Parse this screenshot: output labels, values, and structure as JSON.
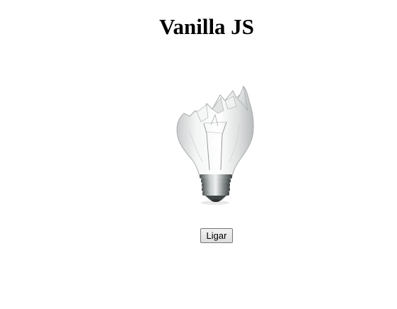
{
  "page": {
    "title": "Vanilla JS"
  },
  "bulb": {
    "state": "broken",
    "icon": "broken-light-bulb-icon"
  },
  "controls": {
    "toggle_label": "Ligar"
  }
}
